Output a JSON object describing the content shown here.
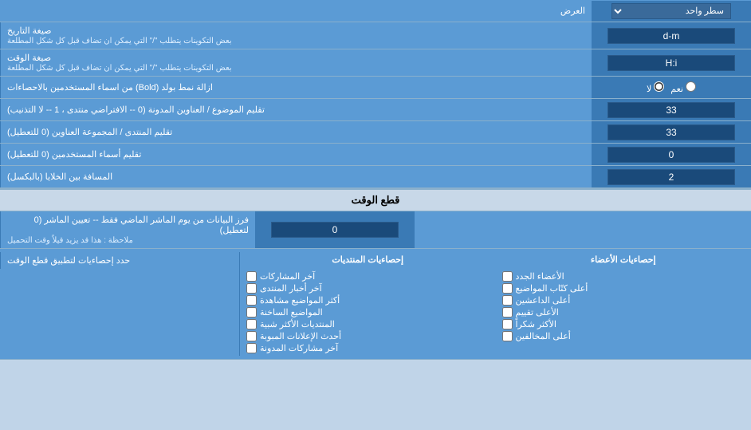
{
  "header": {
    "display_label": "العرض",
    "display_option": "سطر واحد"
  },
  "rows": [
    {
      "id": "date_format",
      "label": "صيغة التاريخ",
      "sublabel": "بعض التكوينات يتطلب \"/\" التي يمكن ان تضاف قبل كل شكل المطلعة",
      "value": "d-m",
      "type": "text"
    },
    {
      "id": "time_format",
      "label": "صيغة الوقت",
      "sublabel": "بعض التكوينات يتطلب \"/\" التي يمكن ان تضاف قبل كل شكل المطلعة",
      "value": "H:i",
      "type": "text"
    },
    {
      "id": "bold_remove",
      "label": "ازالة نمط بولد (Bold) من اسماء المستخدمين بالاحصاءات",
      "type": "radio",
      "option_yes": "نعم",
      "option_no": "لا",
      "selected": "no"
    },
    {
      "id": "thread_title",
      "label": "تقليم الموضوع / العناوين المدونة (0 -- الافتراضي منتدى ، 1 -- لا التذنيب)",
      "value": "33",
      "type": "text"
    },
    {
      "id": "forum_title",
      "label": "تقليم المنتدى / المجموعة العناوين (0 للتعطيل)",
      "value": "33",
      "type": "text"
    },
    {
      "id": "username_trim",
      "label": "تقليم أسماء المستخدمين (0 للتعطيل)",
      "value": "0",
      "type": "text"
    },
    {
      "id": "cell_spacing",
      "label": "المسافة بين الخلايا (بالبكسل)",
      "value": "2",
      "type": "text"
    }
  ],
  "realtime_section": {
    "title": "قطع الوقت",
    "row": {
      "id": "realtime_filter",
      "label_main": "فرز البيانات من يوم الماشر الماضي فقط -- تعيين الماشر (0 لتعطيل)",
      "label_note": "ملاحظة : هذا قد يزيد قيلاً وقت التحميل",
      "value": "0",
      "type": "text"
    },
    "limit_label": "حدد إحصاءيات لتطبيق قطع الوقت"
  },
  "checkboxes": {
    "col1_header": "إحصاءيات المنتديات",
    "col2_header": "إحصاءيات الأعضاء",
    "col1_items": [
      {
        "id": "cb_last_posts",
        "label": "آخر المشاركات",
        "checked": false
      },
      {
        "id": "cb_last_news",
        "label": "آخر أخبار المنتدى",
        "checked": false
      },
      {
        "id": "cb_most_viewed",
        "label": "أكثر المواضيع مشاهدة",
        "checked": false
      },
      {
        "id": "cb_old_topics",
        "label": "المواضيع الساخنة",
        "checked": false
      },
      {
        "id": "cb_similar_forums",
        "label": "المنتديات الأكثر شبية",
        "checked": false
      },
      {
        "id": "cb_recent_ads",
        "label": "أحدث الإعلانات المبوبة",
        "checked": false
      },
      {
        "id": "cb_noted_participations",
        "label": "آخر مشاركات المدونة",
        "checked": false
      }
    ],
    "col2_items": [
      {
        "id": "cb_new_members",
        "label": "الأعضاء الجدد",
        "checked": false
      },
      {
        "id": "cb_top_posters",
        "label": "أعلى كتّاب المواضيع",
        "checked": false
      },
      {
        "id": "cb_top_active",
        "label": "أعلى الداعشين",
        "checked": false
      },
      {
        "id": "cb_top_rated",
        "label": "الأعلى تقييم",
        "checked": false
      },
      {
        "id": "cb_most_thanked",
        "label": "الأكثر شكراً",
        "checked": false
      },
      {
        "id": "cb_top_visitors",
        "label": "أعلى المخالفين",
        "checked": false
      }
    ]
  }
}
